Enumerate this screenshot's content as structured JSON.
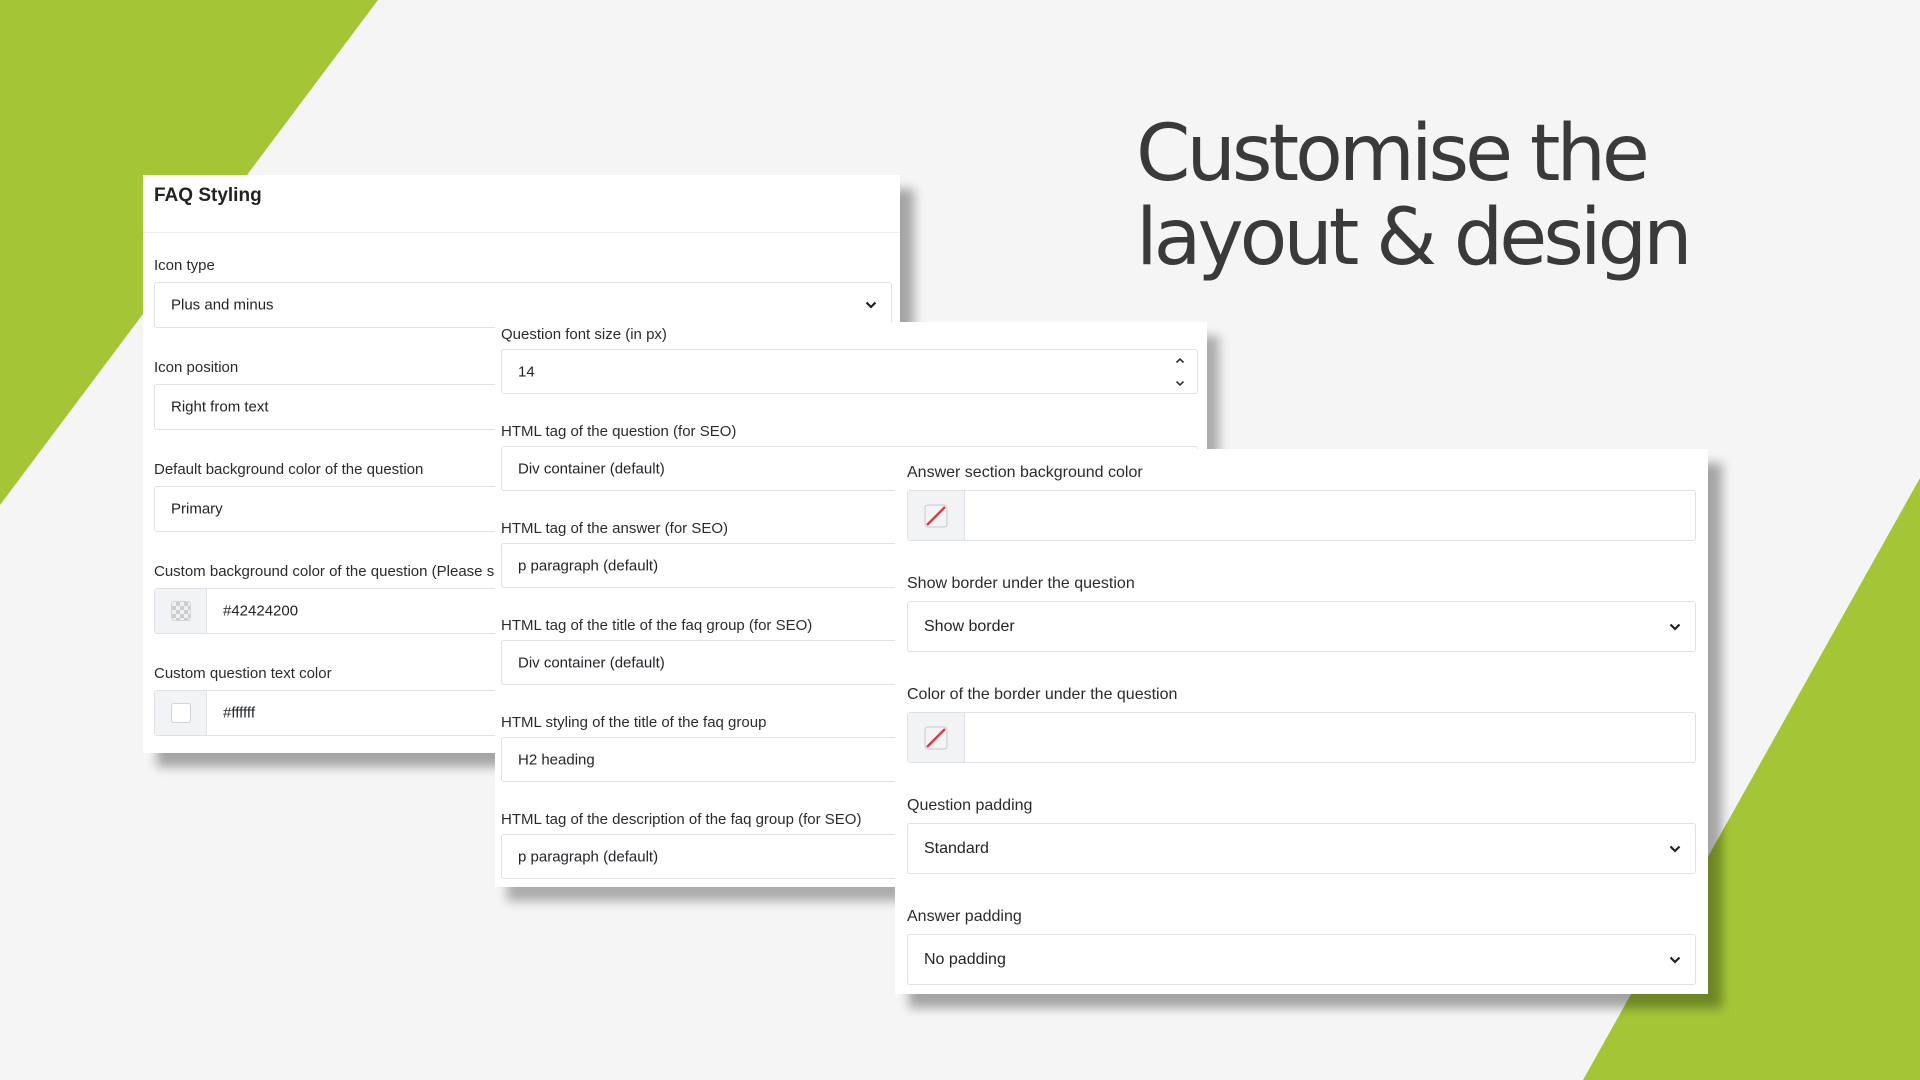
{
  "headline": {
    "line1": "Customise the",
    "line2": "layout & design"
  },
  "colors": {
    "accent_green": "#a4c636",
    "background": "#f5f5f5"
  },
  "panel_faq_styling": {
    "title": "FAQ Styling",
    "icon_type": {
      "label": "Icon type",
      "value": "Plus and minus"
    },
    "icon_position": {
      "label": "Icon position",
      "value": "Right from text"
    },
    "default_bg_color": {
      "label": "Default background color of the question",
      "value": "Primary"
    },
    "custom_bg_color": {
      "label": "Custom background color of the question (Please s",
      "value": "#42424200",
      "swatch_icon": "transparent-checker-icon"
    },
    "custom_text_color": {
      "label": "Custom question text color",
      "value": "#ffffff",
      "swatch_icon": "white-swatch-icon"
    }
  },
  "panel_seo": {
    "font_size": {
      "label": "Question font size (in px)",
      "value": "14"
    },
    "question_tag": {
      "label": "HTML tag of the question (for SEO)",
      "value": "Div container (default)"
    },
    "answer_tag": {
      "label": "HTML tag of the answer (for SEO)",
      "value": "p paragraph (default)"
    },
    "group_title_tag": {
      "label": "HTML tag of the title of the faq group (for SEO)",
      "value": "Div container (default)"
    },
    "group_title_styling": {
      "label": "HTML styling of the title of the faq group",
      "value": "H2 heading"
    },
    "group_desc_tag": {
      "label": "HTML tag of the description of the faq group (for SEO)",
      "value": "p paragraph (default)"
    }
  },
  "panel_answer": {
    "answer_bg_color": {
      "label": "Answer section background color",
      "value": "",
      "swatch_icon": "no-color-icon"
    },
    "show_border": {
      "label": "Show border under the question",
      "value": "Show border"
    },
    "border_color": {
      "label": "Color of the border under the question",
      "value": "",
      "swatch_icon": "no-color-icon"
    },
    "question_padding": {
      "label": "Question padding",
      "value": "Standard"
    },
    "answer_padding": {
      "label": "Answer padding",
      "value": "No padding"
    }
  }
}
